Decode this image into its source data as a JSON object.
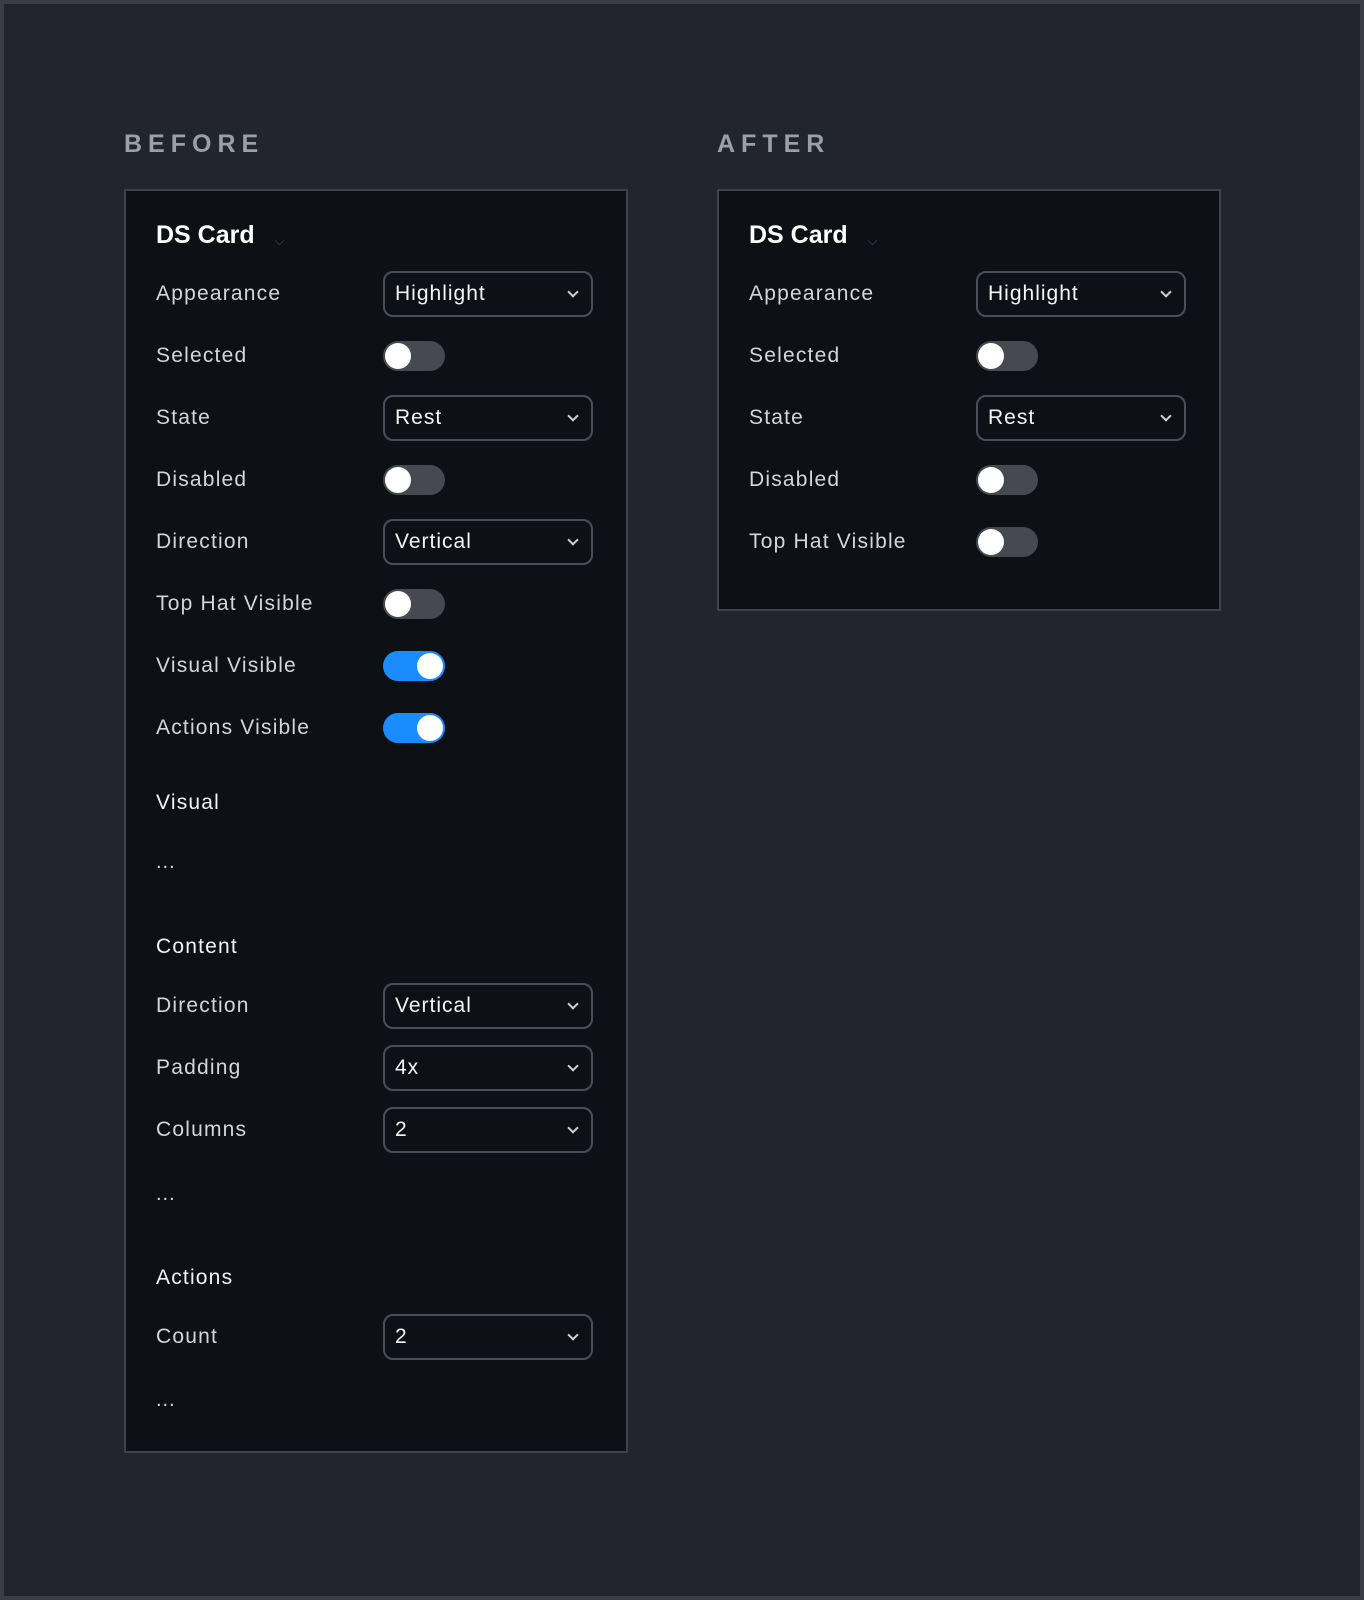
{
  "before": {
    "heading": "BEFORE",
    "title": "DS Card",
    "appearance": {
      "label": "Appearance",
      "value": "Highlight"
    },
    "selected": {
      "label": "Selected",
      "on": false
    },
    "state": {
      "label": "State",
      "value": "Rest"
    },
    "disabled": {
      "label": "Disabled",
      "on": false
    },
    "direction": {
      "label": "Direction",
      "value": "Vertical"
    },
    "top_hat_visible": {
      "label": "Top Hat Visible",
      "on": false
    },
    "visual_visible": {
      "label": "Visual Visible",
      "on": true
    },
    "actions_visible": {
      "label": "Actions Visible",
      "on": true
    },
    "visual_section": {
      "title": "Visual",
      "ellipsis": "..."
    },
    "content_section": {
      "title": "Content",
      "direction": {
        "label": "Direction",
        "value": "Vertical"
      },
      "padding": {
        "label": "Padding",
        "value": "4x"
      },
      "columns": {
        "label": "Columns",
        "value": "2"
      },
      "ellipsis": "..."
    },
    "actions_section": {
      "title": "Actions",
      "count": {
        "label": "Count",
        "value": "2"
      },
      "ellipsis": "..."
    }
  },
  "after": {
    "heading": "AFTER",
    "title": "DS Card",
    "appearance": {
      "label": "Appearance",
      "value": "Highlight"
    },
    "selected": {
      "label": "Selected",
      "on": false
    },
    "state": {
      "label": "State",
      "value": "Rest"
    },
    "disabled": {
      "label": "Disabled",
      "on": false
    },
    "top_hat_visible": {
      "label": "Top Hat Visible",
      "on": false
    }
  },
  "colors": {
    "background": "#22262c",
    "panel": "#0d1014",
    "toggle_on": "#1a8cff",
    "toggle_off": "#464a50"
  }
}
